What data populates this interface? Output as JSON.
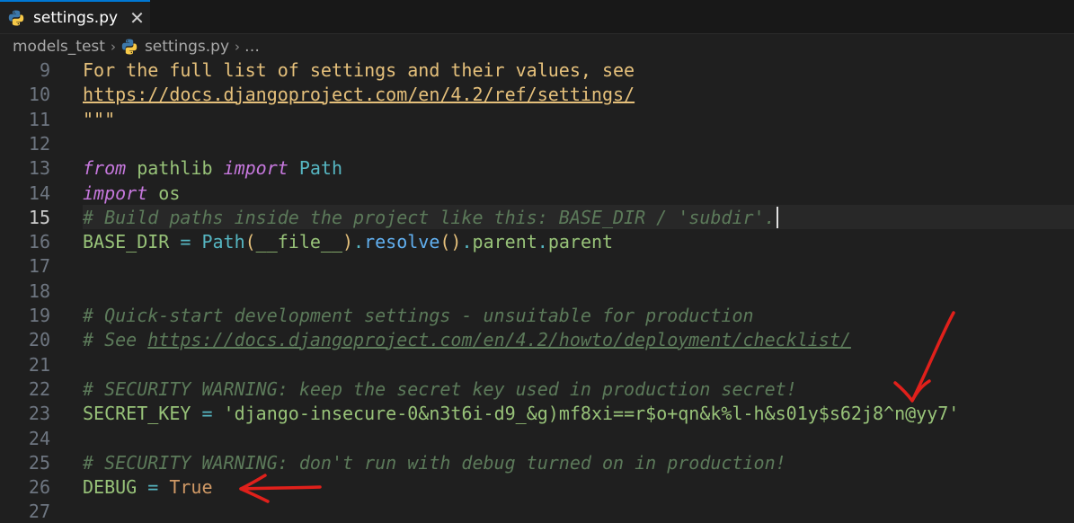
{
  "tab": {
    "filename": "settings.py",
    "close_glyph": "✕"
  },
  "breadcrumbs": {
    "folder": "models_test",
    "file": "settings.py",
    "ellipsis": "…"
  },
  "colors": {
    "accent": "#0078d4",
    "arrow": "#e0201b"
  },
  "current_line": 15,
  "lines": [
    {
      "n": "9",
      "tokens": [
        {
          "c": "t-doc",
          "t": "For the full list of settings and their values, see"
        }
      ]
    },
    {
      "n": "10",
      "tokens": [
        {
          "c": "t-doclink",
          "t": "https://docs.djangoproject.com/en/4.2/ref/settings/"
        }
      ]
    },
    {
      "n": "11",
      "tokens": [
        {
          "c": "t-doc",
          "t": "\"\"\""
        }
      ]
    },
    {
      "n": "12",
      "tokens": []
    },
    {
      "n": "13",
      "tokens": [
        {
          "c": "t-kw",
          "t": "from"
        },
        {
          "c": "t-mod",
          "t": " pathlib "
        },
        {
          "c": "t-kw",
          "t": "import"
        },
        {
          "c": "t-cls",
          "t": " Path"
        }
      ]
    },
    {
      "n": "14",
      "tokens": [
        {
          "c": "t-kw",
          "t": "import"
        },
        {
          "c": "t-mod",
          "t": " os"
        }
      ]
    },
    {
      "n": "15",
      "tokens": [
        {
          "c": "t-cmt",
          "t": "# Build paths inside the project like this: BASE_DIR / 'subdir'."
        }
      ],
      "caret": true
    },
    {
      "n": "16",
      "tokens": [
        {
          "c": "t-var",
          "t": "BASE_DIR"
        },
        {
          "c": "t-op",
          "t": " = "
        },
        {
          "c": "t-cls",
          "t": "Path"
        },
        {
          "c": "t-paren",
          "t": "("
        },
        {
          "c": "t-dunder",
          "t": "__file__"
        },
        {
          "c": "t-paren",
          "t": ")"
        },
        {
          "c": "t-op",
          "t": "."
        },
        {
          "c": "t-fn",
          "t": "resolve"
        },
        {
          "c": "t-paren",
          "t": "()"
        },
        {
          "c": "t-op",
          "t": "."
        },
        {
          "c": "t-attr",
          "t": "parent"
        },
        {
          "c": "t-op",
          "t": "."
        },
        {
          "c": "t-attr",
          "t": "parent"
        }
      ]
    },
    {
      "n": "17",
      "tokens": []
    },
    {
      "n": "18",
      "tokens": []
    },
    {
      "n": "19",
      "tokens": [
        {
          "c": "t-cmt",
          "t": "# Quick-start development settings - unsuitable for production"
        }
      ]
    },
    {
      "n": "20",
      "tokens": [
        {
          "c": "t-cmt",
          "t": "# See "
        },
        {
          "c": "t-cmtlink",
          "t": "https://docs.djangoproject.com/en/4.2/howto/deployment/checklist/"
        }
      ]
    },
    {
      "n": "21",
      "tokens": []
    },
    {
      "n": "22",
      "tokens": [
        {
          "c": "t-cmt",
          "t": "# SECURITY WARNING: keep the secret key used in production secret!"
        }
      ]
    },
    {
      "n": "23",
      "tokens": [
        {
          "c": "t-var",
          "t": "SECRET_KEY"
        },
        {
          "c": "t-op",
          "t": " = "
        },
        {
          "c": "t-str",
          "t": "'django-insecure-0&n3t6i-d9_&g)mf8xi==r$o+qn&k%l-h&s01y$s62j8^n@yy7'"
        }
      ]
    },
    {
      "n": "24",
      "tokens": []
    },
    {
      "n": "25",
      "tokens": [
        {
          "c": "t-cmt",
          "t": "# SECURITY WARNING: don't run with debug turned on in production!"
        }
      ]
    },
    {
      "n": "26",
      "tokens": [
        {
          "c": "t-var",
          "t": "DEBUG"
        },
        {
          "c": "t-op",
          "t": " = "
        },
        {
          "c": "t-bool",
          "t": "True"
        }
      ]
    },
    {
      "n": "27",
      "tokens": []
    }
  ]
}
